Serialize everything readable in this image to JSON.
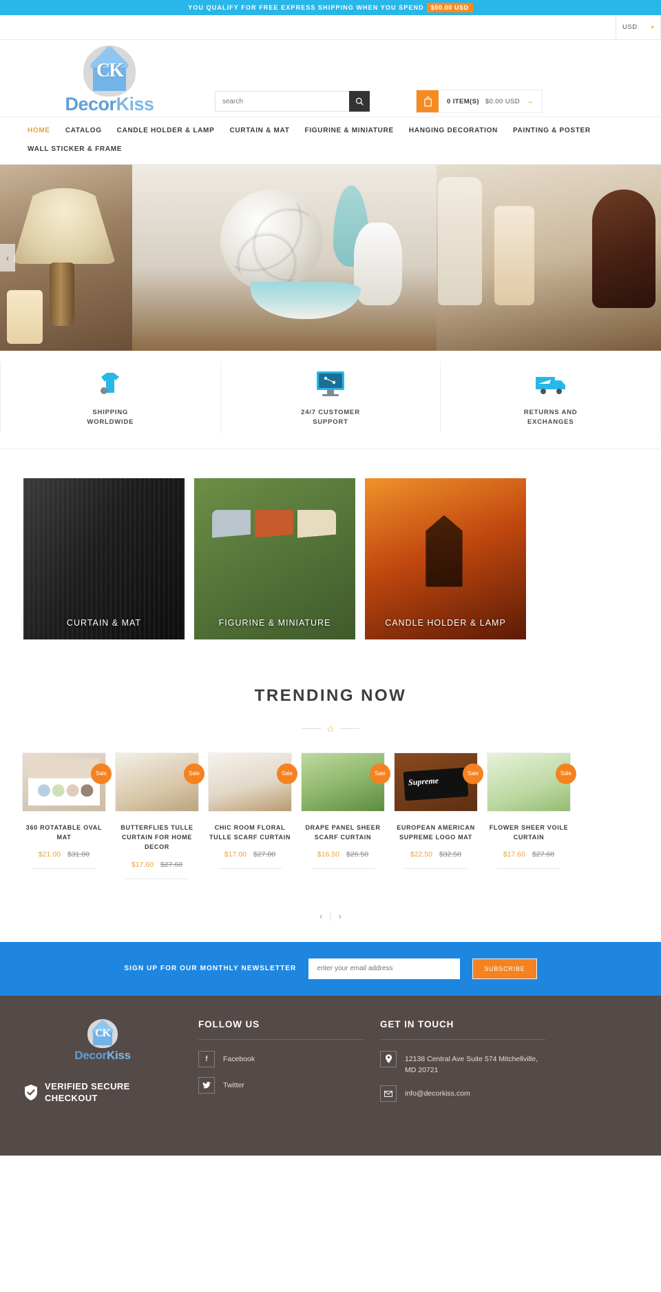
{
  "promo": {
    "message": "YOU QUALIFY FOR FREE EXPRESS SHIPPING WHEN YOU SPEND",
    "amount": "$50.00 USD",
    "bg_color": "#29b6e8",
    "amount_color": "#f78b1f"
  },
  "currency": {
    "selected": "USD",
    "caret": "▼"
  },
  "brand": {
    "mark": "CK",
    "name_part1": "Decor",
    "name_part2": "Kiss"
  },
  "search": {
    "placeholder": "search",
    "value": "",
    "button_icon": "search-icon"
  },
  "cart": {
    "icon": "bag-icon",
    "items_label": "0 ITEM(S)",
    "total": "$0.00 USD",
    "arrow": "→"
  },
  "nav": {
    "items": [
      {
        "label": "HOME",
        "active": true
      },
      {
        "label": "CATALOG",
        "active": false
      },
      {
        "label": "CANDLE HOLDER & LAMP",
        "active": false
      },
      {
        "label": "CURTAIN & MAT",
        "active": false
      },
      {
        "label": "FIGURINE & MINIATURE",
        "active": false
      },
      {
        "label": "HANGING DECORATION",
        "active": false
      },
      {
        "label": "PAINTING & POSTER",
        "active": false
      },
      {
        "label": "WALL STICKER & FRAME",
        "active": false
      }
    ]
  },
  "hero": {
    "prev_arrow": "‹"
  },
  "services": [
    {
      "icon": "tshirt-icon",
      "line1": "SHIPPING",
      "line2": "WORLDWIDE"
    },
    {
      "icon": "monitor-icon",
      "line1": "24/7 CUSTOMER",
      "line2": "SUPPORT"
    },
    {
      "icon": "truck-icon",
      "line1": "RETURNS AND",
      "line2": "EXCHANGES"
    }
  ],
  "categories": [
    {
      "label": "CURTAIN & MAT"
    },
    {
      "label": "FIGURINE & MINIATURE"
    },
    {
      "label": "CANDLE HOLDER & LAMP"
    }
  ],
  "trending": {
    "title": "TRENDING NOW",
    "star": "☆",
    "sale_badge": "Sale",
    "prev": "‹",
    "next": "›",
    "separator": "|",
    "products": [
      {
        "name": "360 ROTATABLE OVAL MAT",
        "price": "$21.00",
        "compare_at": "$31.00",
        "on_sale": true
      },
      {
        "name": "BUTTERFLIES TULLE CURTAIN FOR HOME DECOR",
        "price": "$17.60",
        "compare_at": "$27.60",
        "on_sale": true
      },
      {
        "name": "CHIC ROOM FLORAL TULLE SCARF CURTAIN",
        "price": "$17.00",
        "compare_at": "$27.00",
        "on_sale": true
      },
      {
        "name": "DRAPE PANEL SHEER SCARF CURTAIN",
        "price": "$16.50",
        "compare_at": "$26.50",
        "on_sale": true
      },
      {
        "name": "EUROPEAN AMERICAN SUPREME LOGO MAT",
        "price": "$22.50",
        "compare_at": "$32.50",
        "on_sale": true,
        "overlay_text": "Supreme"
      },
      {
        "name": "FLOWER SHEER VOILE CURTAIN",
        "price": "$17.60",
        "compare_at": "$27.60",
        "on_sale": true
      }
    ]
  },
  "newsletter": {
    "heading": "SIGN UP FOR OUR MONTHLY NEWSLETTER",
    "placeholder": "enter your email address",
    "value": "",
    "button": "SUBSCRIBE",
    "bg_color": "#1f86e0",
    "button_color": "#f58220"
  },
  "footer": {
    "verified_line1": "VERIFIED SECURE",
    "verified_line2": "CHECKOUT",
    "follow": {
      "title": "FOLLOW US",
      "links": [
        {
          "icon": "facebook-icon",
          "glyph": "f",
          "label": "Facebook"
        },
        {
          "icon": "twitter-icon",
          "glyph": "ᴠ",
          "label": "Twitter"
        }
      ]
    },
    "contact": {
      "title": "GET IN TOUCH",
      "rows": [
        {
          "icon": "location-pin-icon",
          "glyph": "◉",
          "text": "12138 Central Ave Suite 574 Mitchellville, MD 20721"
        },
        {
          "icon": "envelope-icon",
          "glyph": "✉",
          "text": "info@decorkiss.com"
        }
      ]
    }
  }
}
